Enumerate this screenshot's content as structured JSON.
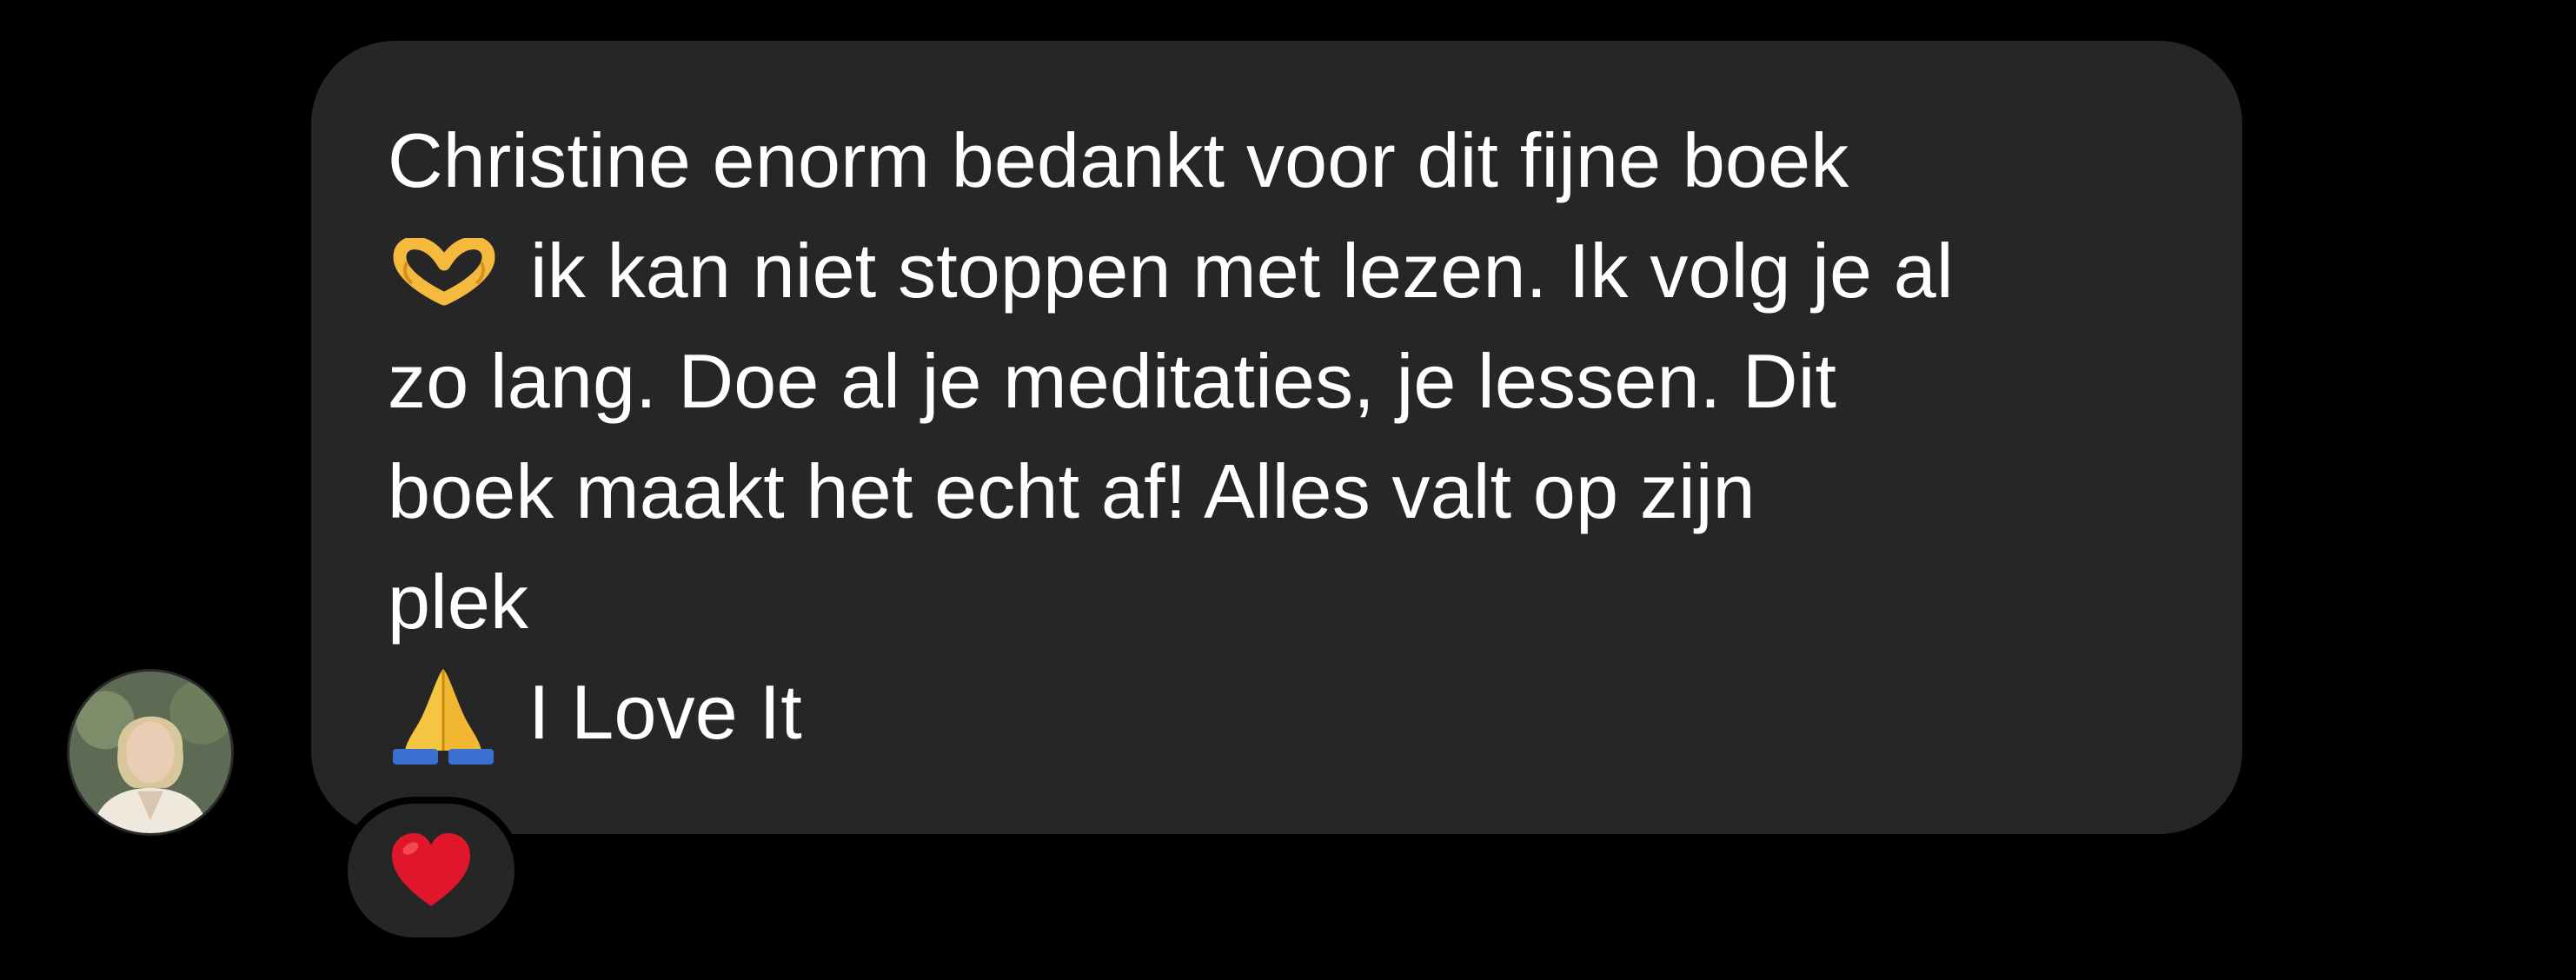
{
  "message": {
    "lines": [
      "Christine enorm bedankt voor dit fijne boek",
      "ik kan niet stoppen met lezen. Ik volg je al",
      "zo lang. Doe al je meditaties, je lessen. Dit",
      "boek maakt het echt af! Alles valt op zijn",
      "plek",
      "I Love It"
    ],
    "inline_emojis": [
      "heart-hands-emoji",
      "folded-hands-emoji"
    ]
  },
  "sender": {
    "avatar_icon": "profile-photo-avatar"
  },
  "reaction": {
    "emoji": "red-heart-emoji",
    "color": "#e0162b"
  },
  "colors": {
    "background": "#000000",
    "bubble": "#262626",
    "text": "#ffffff"
  }
}
